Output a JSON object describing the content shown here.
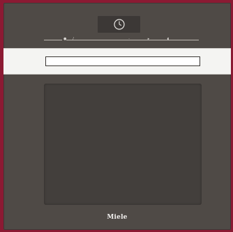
{
  "appliance": {
    "brand_logo": "Miele",
    "display_icon": "clock-icon",
    "control_symbols": [
      "power-icon",
      "menu-icon",
      "light-icon",
      "play-icon",
      "timer-icon"
    ]
  },
  "colors": {
    "background": "#8b1a33",
    "body": "#4f4a46",
    "handle": "#f4f4f2",
    "window": "#433f3c"
  }
}
